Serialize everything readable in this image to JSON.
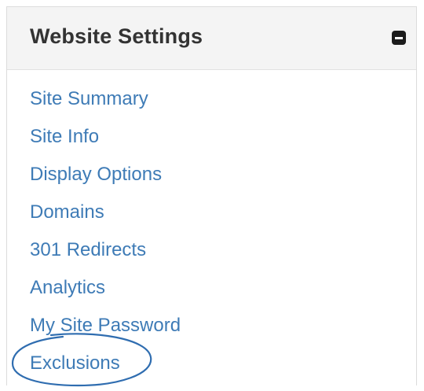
{
  "panel": {
    "title": "Website Settings",
    "collapse_icon": "minus-square-icon"
  },
  "menu": {
    "items": [
      {
        "label": "Site Summary"
      },
      {
        "label": "Site Info"
      },
      {
        "label": "Display Options"
      },
      {
        "label": "Domains"
      },
      {
        "label": "301 Redirects"
      },
      {
        "label": "Analytics"
      },
      {
        "label": "My Site Password"
      },
      {
        "label": "Exclusions"
      }
    ]
  },
  "annotation": {
    "shape": "ellipse",
    "color": "#2f6db0",
    "highlights": "Exclusions"
  },
  "colors": {
    "link": "#3e7bb6",
    "header_bg": "#f4f4f4",
    "title": "#333333"
  }
}
